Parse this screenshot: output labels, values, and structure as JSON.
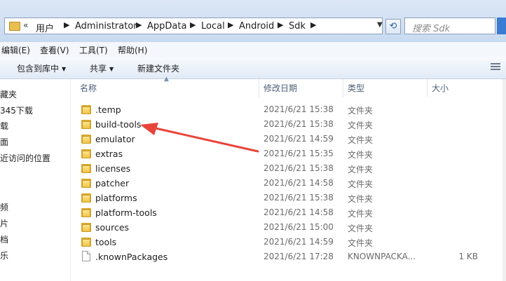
{
  "address_bar": {
    "overflow_chevron": "«",
    "crumbs": [
      "用户",
      "Administrator",
      "AppData",
      "Local",
      "Android",
      "Sdk"
    ]
  },
  "search": {
    "placeholder": "搜索 Sdk"
  },
  "menu": {
    "items": [
      "编辑(E)",
      "查看(V)",
      "工具(T)",
      "帮助(H)"
    ]
  },
  "toolbar": {
    "include_library": "包含到库中",
    "share": "共享",
    "new_folder": "新建文件夹"
  },
  "nav_pane": {
    "items": [
      "藏夹",
      "345下载",
      "载",
      "面",
      "近访问的位置",
      "频",
      "片",
      "档",
      "乐"
    ]
  },
  "columns": {
    "name": "名称",
    "modified": "修改日期",
    "type": "类型",
    "size": "大小"
  },
  "files": [
    {
      "name": ".temp",
      "modified": "2021/6/21 15:38",
      "type": "文件夹",
      "size": "",
      "icon": "folder-icon"
    },
    {
      "name": "build-tools",
      "modified": "2021/6/21 15:38",
      "type": "文件夹",
      "size": "",
      "icon": "folder-icon"
    },
    {
      "name": "emulator",
      "modified": "2021/6/21 14:59",
      "type": "文件夹",
      "size": "",
      "icon": "folder-icon"
    },
    {
      "name": "extras",
      "modified": "2021/6/21 15:35",
      "type": "文件夹",
      "size": "",
      "icon": "folder-icon"
    },
    {
      "name": "licenses",
      "modified": "2021/6/21 15:38",
      "type": "文件夹",
      "size": "",
      "icon": "folder-icon"
    },
    {
      "name": "patcher",
      "modified": "2021/6/21 14:58",
      "type": "文件夹",
      "size": "",
      "icon": "folder-icon"
    },
    {
      "name": "platforms",
      "modified": "2021/6/21 15:38",
      "type": "文件夹",
      "size": "",
      "icon": "folder-icon"
    },
    {
      "name": "platform-tools",
      "modified": "2021/6/21 14:58",
      "type": "文件夹",
      "size": "",
      "icon": "folder-icon"
    },
    {
      "name": "sources",
      "modified": "2021/6/21 15:00",
      "type": "文件夹",
      "size": "",
      "icon": "folder-icon"
    },
    {
      "name": "tools",
      "modified": "2021/6/21 14:59",
      "type": "文件夹",
      "size": "",
      "icon": "folder-icon"
    },
    {
      "name": ".knownPackages",
      "modified": "2021/6/21 17:28",
      "type": "KNOWNPACKA...",
      "size": "1 KB",
      "icon": "file-icon"
    }
  ],
  "annotation": {
    "color": "#e8443a",
    "target": "build-tools"
  },
  "colors": {
    "accent": "#3b7bd3",
    "folder": "#f2c445"
  }
}
